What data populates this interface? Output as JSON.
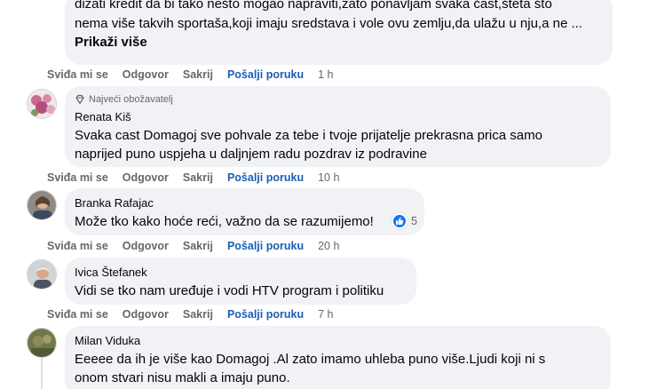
{
  "actions": {
    "like": "Sviđa mi se",
    "reply": "Odgovor",
    "hide": "Sakrij",
    "message": "Pošalji poruku"
  },
  "comments": [
    {
      "author": "",
      "lines": [
        "dizati kredit da bi tako nešto mogao napraviti,zato ponavljam svaka čast,šteta što",
        "nema više takvih sportaša,koji imaju sredstava i vole ovu zemlju,da ulažu u nju,a ne ..."
      ],
      "see_more": "Prikaži više",
      "time": "1 h"
    },
    {
      "badge": "Najveći obožavatelj",
      "author": "Renata Kiš",
      "lines": [
        "Svaka cast Domagoj sve pohvale za tebe i tvoje prijatelje prekrasna prica samo",
        "naprijed puno uspjeha u daljnjem radu pozdrav iz podravine"
      ],
      "time": "10 h"
    },
    {
      "author": "Branka Rafajac",
      "lines": [
        "Može tko kako hoće reći, važno da se razumijemo!"
      ],
      "reaction_icon": "like-icon",
      "reaction_count": "5",
      "time": "20 h"
    },
    {
      "author": "Ivica Štefanek",
      "lines": [
        "Vidi se tko nam uređuje i vodi HTV program i politiku"
      ],
      "time": "7 h"
    },
    {
      "author": "Milan Viduka",
      "lines": [
        "Eeeee da ih je više kao Domagoj .Al zato imamo uhleba puno više.Ljudi koji ni s",
        "onom stvari nisu makli a imaju puno."
      ]
    }
  ]
}
